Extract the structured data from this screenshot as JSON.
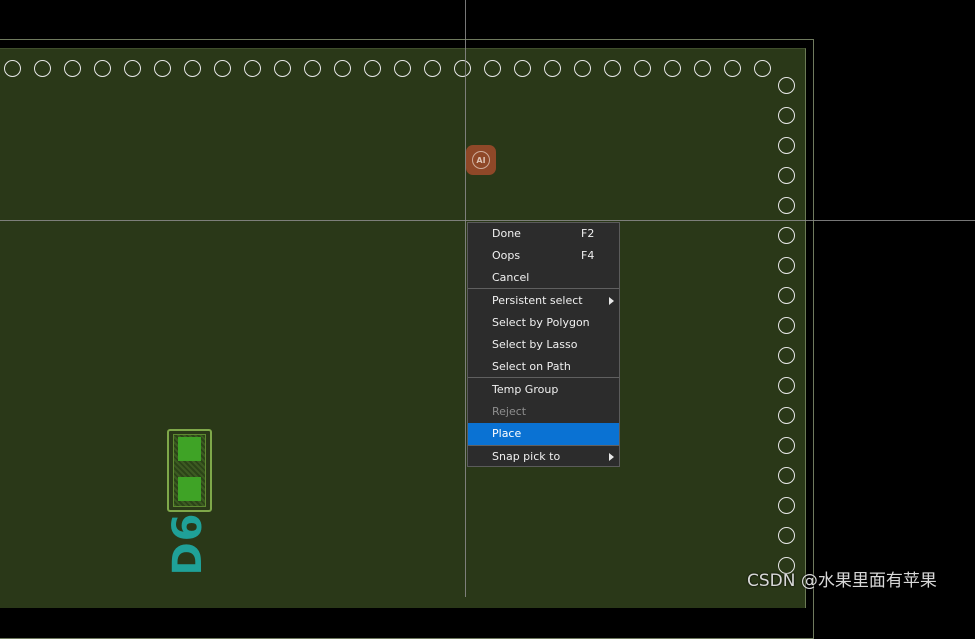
{
  "menu": {
    "items": [
      {
        "label": "Done",
        "shortcut": "F2",
        "submenu": false,
        "disabled": false,
        "selected": false
      },
      {
        "label": "Oops",
        "shortcut": "F4",
        "submenu": false,
        "disabled": false,
        "selected": false
      },
      {
        "label": "Cancel",
        "shortcut": "",
        "submenu": false,
        "disabled": false,
        "selected": false
      },
      {
        "label": "Persistent select",
        "shortcut": "",
        "submenu": true,
        "disabled": false,
        "selected": false
      },
      {
        "label": "Select by Polygon",
        "shortcut": "",
        "submenu": false,
        "disabled": false,
        "selected": false
      },
      {
        "label": "Select by Lasso",
        "shortcut": "",
        "submenu": false,
        "disabled": false,
        "selected": false
      },
      {
        "label": "Select on Path",
        "shortcut": "",
        "submenu": false,
        "disabled": false,
        "selected": false
      },
      {
        "label": "Temp Group",
        "shortcut": "",
        "submenu": false,
        "disabled": false,
        "selected": false
      },
      {
        "label": "Reject",
        "shortcut": "",
        "submenu": false,
        "disabled": true,
        "selected": false
      },
      {
        "label": "Place",
        "shortcut": "",
        "submenu": false,
        "disabled": false,
        "selected": true
      },
      {
        "label": "Snap pick to",
        "shortcut": "",
        "submenu": true,
        "disabled": false,
        "selected": false
      }
    ]
  },
  "canvas": {
    "designator": "D6",
    "ai_badge": "AI"
  },
  "watermark": "CSDN @水果里面有苹果",
  "colors": {
    "board": "#2a3818",
    "via": "#e6e6e6",
    "pad": "#3fa326",
    "silkscreen": "#1fa198",
    "menu_bg": "#2c2c2c",
    "menu_selected": "#0a72d3"
  }
}
